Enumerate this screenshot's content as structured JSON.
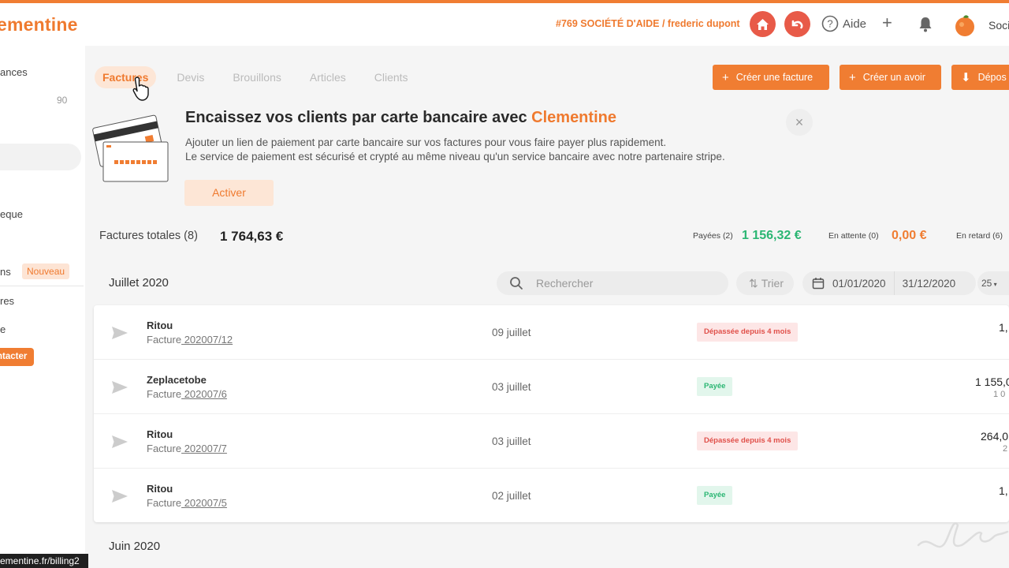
{
  "topbar": {
    "logo": "ementine",
    "company": "#769 SOCIÉTÉ D'AIDE / frederic dupont",
    "help_label": "Aide",
    "user_name": "Soci",
    "icons": [
      "home-icon",
      "undo-icon",
      "help-icon",
      "plus-icon",
      "bell-icon"
    ]
  },
  "sidebar": {
    "items": [
      {
        "label": "ances"
      },
      {
        "label": "eque"
      },
      {
        "label": "ns"
      },
      {
        "label": "res"
      },
      {
        "label": "e"
      }
    ],
    "count": "90",
    "new_badge": "Nouveau",
    "contact_label": "ntacter",
    "url_tooltip": "ementine.fr/billing2"
  },
  "tabs": [
    {
      "label": "Factures",
      "active": true
    },
    {
      "label": "Devis",
      "active": false
    },
    {
      "label": "Brouillons",
      "active": false
    },
    {
      "label": "Articles",
      "active": false
    },
    {
      "label": "Clients",
      "active": false
    }
  ],
  "actions": {
    "create_invoice": "Créer une facture",
    "create_credit": "Créer un avoir",
    "deposit": "Dépos"
  },
  "promo": {
    "title": "Encaissez vos clients par carte bancaire avec",
    "brand": "Clementine",
    "line1": "Ajouter un lien de paiement par carte bancaire sur vos factures pour vous faire payer plus rapidement.",
    "line2": "Le service de paiement est sécurisé et crypté au même niveau qu'un service bancaire avec notre partenaire stripe.",
    "activate": "Activer",
    "close": "×"
  },
  "totals": {
    "label": "Factures totales (8)",
    "amount": "1 764,63 €",
    "paid_label": "Payées (2)",
    "paid_amount": "1 156,32 €",
    "pending_label": "En attente (0)",
    "pending_amount": "0,00 €",
    "late_label": "En retard (6)"
  },
  "filters": {
    "month": "Juillet 2020",
    "search_placeholder": "Rechercher",
    "sort": "Trier",
    "date_from": "01/01/2020",
    "date_to": "31/12/2020",
    "per_page": "25"
  },
  "invoices": [
    {
      "client": "Ritou",
      "doc": "Facture",
      "ref": " 202007/12",
      "date": "09 juillet",
      "status": "Dépassée depuis 4 mois",
      "amount": "1,",
      "sub": ""
    },
    {
      "client": "Zeplacetobe",
      "doc": "Facture",
      "ref": " 202007/6",
      "date": "03 juillet",
      "status": "Payée",
      "amount": "1 155,0",
      "sub": "1 0"
    },
    {
      "client": "Ritou",
      "doc": "Facture",
      "ref": " 202007/7",
      "date": "03 juillet",
      "status": "Dépassée depuis 4 mois",
      "amount": "264,0",
      "sub": "2"
    },
    {
      "client": "Ritou",
      "doc": "Facture",
      "ref": " 202007/5",
      "date": "02 juillet",
      "status": "Payée",
      "amount": "1,",
      "sub": ""
    }
  ],
  "next_month": "Juin 2020",
  "colors": {
    "accent": "#f07d32",
    "paid": "#2bb673",
    "late": "#e0504a",
    "home": "#e85a48"
  }
}
